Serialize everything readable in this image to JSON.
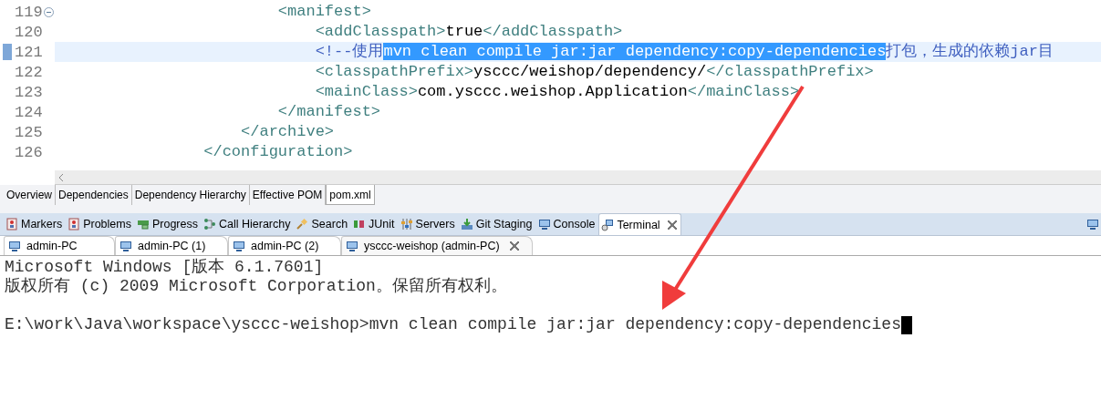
{
  "editor": {
    "lines": [
      {
        "number": "119",
        "fold": true,
        "current": false,
        "segments": [
          {
            "kind": "tag",
            "text": "                        <manifest>"
          }
        ]
      },
      {
        "number": "120",
        "fold": false,
        "current": false,
        "segments": [
          {
            "kind": "tag",
            "text": "                            <addClasspath>"
          },
          {
            "kind": "text",
            "text": "true"
          },
          {
            "kind": "tag",
            "text": "</addClasspath>"
          }
        ]
      },
      {
        "number": "121",
        "fold": false,
        "current": true,
        "segments": [
          {
            "kind": "comment",
            "text": "                            <!--使用"
          },
          {
            "kind": "selection",
            "text": "mvn clean compile jar:jar dependency:copy-dependencies"
          },
          {
            "kind": "comment",
            "text": "打包，生成的依赖jar目"
          }
        ]
      },
      {
        "number": "122",
        "fold": false,
        "current": false,
        "segments": [
          {
            "kind": "tag",
            "text": "                            <classpathPrefix>"
          },
          {
            "kind": "text",
            "text": "ysccc/weishop/dependency/"
          },
          {
            "kind": "tag",
            "text": "</classpathPrefix>"
          }
        ]
      },
      {
        "number": "123",
        "fold": false,
        "current": false,
        "segments": [
          {
            "kind": "tag",
            "text": "                            <mainClass>"
          },
          {
            "kind": "text",
            "text": "com.ysccc.weishop.Application"
          },
          {
            "kind": "tag",
            "text": "</mainClass>"
          }
        ]
      },
      {
        "number": "124",
        "fold": false,
        "current": false,
        "segments": [
          {
            "kind": "tag",
            "text": "                        </manifest>"
          }
        ]
      },
      {
        "number": "125",
        "fold": false,
        "current": false,
        "segments": [
          {
            "kind": "tag",
            "text": "                    </archive>"
          }
        ]
      },
      {
        "number": "126",
        "fold": false,
        "current": false,
        "segments": [
          {
            "kind": "tag",
            "text": "                </configuration>"
          }
        ]
      }
    ]
  },
  "editor_tabs": [
    {
      "label": "Overview",
      "selected": false
    },
    {
      "label": "Dependencies",
      "selected": false
    },
    {
      "label": "Dependency Hierarchy",
      "selected": false
    },
    {
      "label": "Effective POM",
      "selected": false
    },
    {
      "label": "pom.xml",
      "selected": true
    }
  ],
  "view_tabs": [
    {
      "label": "Markers",
      "kind": "marker",
      "selected": false
    },
    {
      "label": "Problems",
      "kind": "marker",
      "selected": false
    },
    {
      "label": "Progress",
      "kind": "progress",
      "selected": false
    },
    {
      "label": "Call Hierarchy",
      "kind": "hierarchy",
      "selected": false
    },
    {
      "label": "Search",
      "kind": "search",
      "selected": false
    },
    {
      "label": "JUnit",
      "kind": "junit",
      "selected": false
    },
    {
      "label": "Servers",
      "kind": "servers",
      "selected": false
    },
    {
      "label": "Git Staging",
      "kind": "git",
      "selected": false
    },
    {
      "label": "Console",
      "kind": "monitor",
      "selected": false
    },
    {
      "label": "Terminal",
      "kind": "terminal",
      "selected": true
    }
  ],
  "terminal_tabs": [
    {
      "label": "admin-PC",
      "selected": false
    },
    {
      "label": "admin-PC (1)",
      "selected": false
    },
    {
      "label": "admin-PC (2)",
      "selected": false
    },
    {
      "label": "ysccc-weishop (admin-PC)",
      "selected": true
    }
  ],
  "terminal": {
    "banner": [
      "Microsoft Windows [版本 6.1.7601]",
      "版权所有 (c) 2009 Microsoft Corporation。保留所有权利。"
    ],
    "prompt": "E:\\work\\Java\\workspace\\ysccc-weishop>mvn clean compile jar:jar dependency:copy-dependencies",
    "cursor": true
  }
}
